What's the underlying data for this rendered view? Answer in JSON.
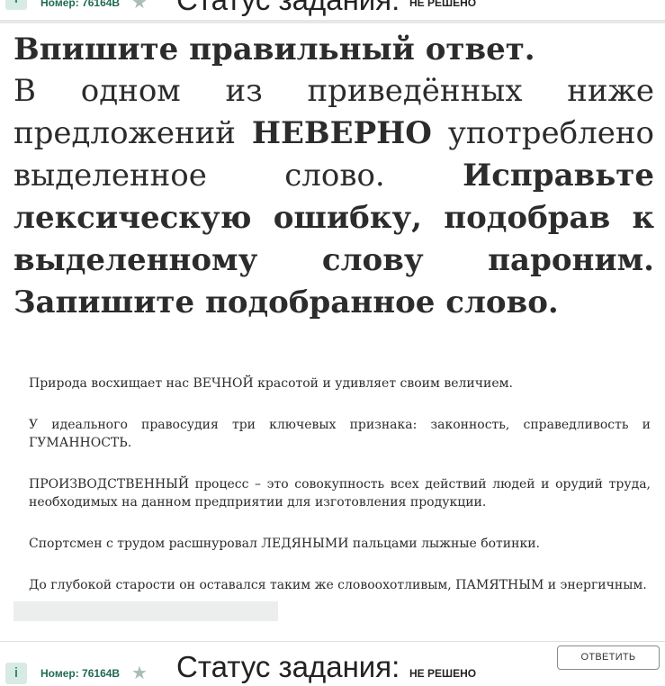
{
  "status_bar": {
    "info_label": "i",
    "number_text": "Номер: 76164В",
    "status_label": "Статус задания:",
    "status_value": "НЕ РЕШЕНО"
  },
  "task": {
    "heading": "Впишите правильный ответ.",
    "intro_part1": "В одном из приведённых ниже предложений ",
    "intro_bold1": "НЕВЕРНО",
    "intro_part2": " употреблено выделенное слово. ",
    "intro_bold2": "Исправьте лексическую ошибку, подобрав к выделенному слову пароним. Запишите подобранное слово."
  },
  "sentences": [
    "Природа восхищает нас ВЕЧНОЙ красотой и удивляет своим величием.",
    "У идеального правосудия три ключевых признака: законность, справедливость и ГУМАННОСТЬ.",
    "ПРОИЗВОДСТВЕННЫЙ процесс – это совокупность всех действий людей и орудий труда, необходимых на данном предприятии для изготовления продукции.",
    "Спортсмен с трудом расшнуровал ЛЕДЯНЫМИ пальцами лыжные ботинки.",
    "До глубокой старости он оставался таким же словоохотливым, ПАМЯТНЫМ и энергичным."
  ],
  "answer": {
    "value": "",
    "button_label": "ОТВЕТИТЬ"
  },
  "colors": {
    "accent": "#3b8c72",
    "badge_bg": "#d7ebe4",
    "input_bg": "#eceeee"
  }
}
